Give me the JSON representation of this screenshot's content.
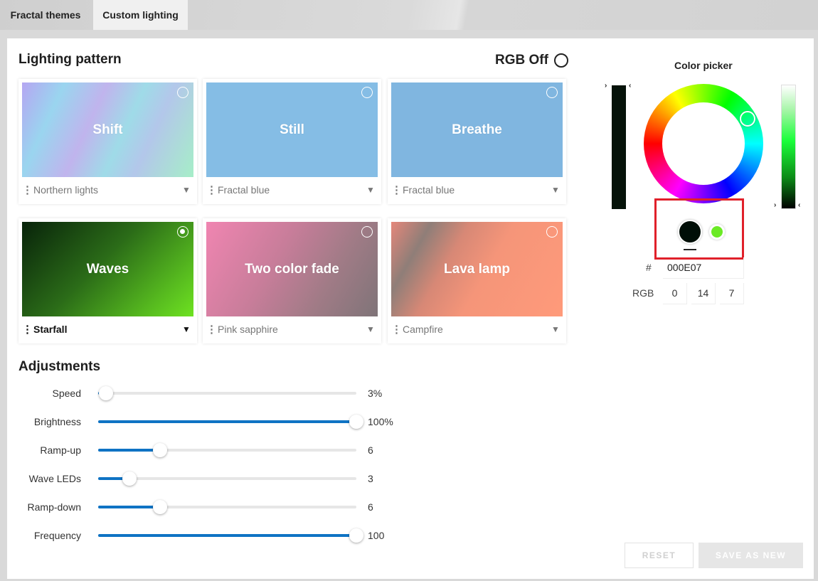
{
  "tabs": [
    {
      "label": "Fractal themes"
    },
    {
      "label": "Custom lighting"
    }
  ],
  "lighting": {
    "title": "Lighting pattern",
    "rgb_off_label": "RGB Off",
    "patterns": [
      {
        "name": "Shift",
        "preset": "Northern lights",
        "selected": false
      },
      {
        "name": "Still",
        "preset": "Fractal blue",
        "selected": false
      },
      {
        "name": "Breathe",
        "preset": "Fractal blue",
        "selected": false
      },
      {
        "name": "Waves",
        "preset": "Starfall",
        "selected": true
      },
      {
        "name": "Two color fade",
        "preset": "Pink sapphire",
        "selected": false
      },
      {
        "name": "Lava lamp",
        "preset": "Campfire",
        "selected": false
      }
    ]
  },
  "adjustments": {
    "title": "Adjustments",
    "sliders": [
      {
        "label": "Speed",
        "value_text": "3%",
        "fraction": 0.03
      },
      {
        "label": "Brightness",
        "value_text": "100%",
        "fraction": 1.0
      },
      {
        "label": "Ramp-up",
        "value_text": "6",
        "fraction": 0.24
      },
      {
        "label": "Wave LEDs",
        "value_text": "3",
        "fraction": 0.12
      },
      {
        "label": "Ramp-down",
        "value_text": "6",
        "fraction": 0.24
      },
      {
        "label": "Frequency",
        "value_text": "100",
        "fraction": 1.0
      }
    ]
  },
  "color_picker": {
    "title": "Color picker",
    "hex_label": "#",
    "hex_value": "000E07",
    "rgb_label": "RGB",
    "r": "0",
    "g": "14",
    "b": "7",
    "primary_color": "#000e07",
    "secondary_color": "#6bea25"
  },
  "buttons": {
    "reset": "RESET",
    "save_as_new": "SAVE AS NEW"
  }
}
